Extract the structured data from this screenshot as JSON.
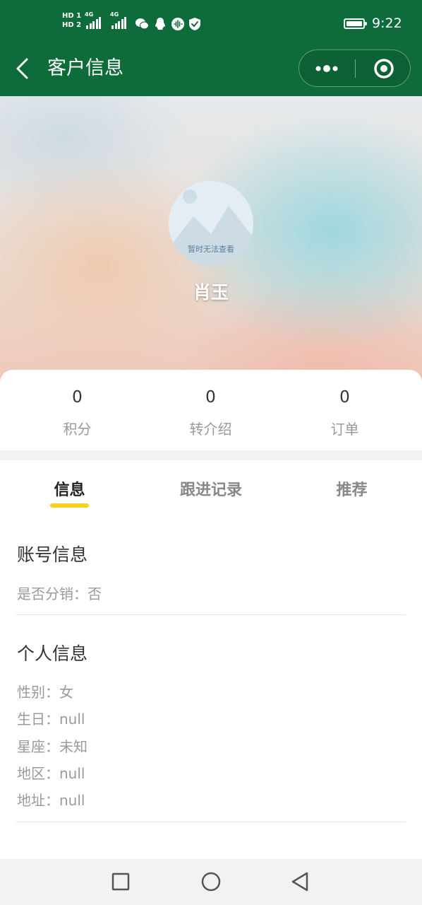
{
  "status_bar": {
    "hd1": "HD 1",
    "hd2": "HD 2",
    "net1": "4G",
    "net2": "4G",
    "battery_level": 1.0,
    "time": "9:22"
  },
  "nav": {
    "title": "客户信息",
    "back_icon": "chevron-left-icon",
    "more_icon": "more-dots-icon",
    "close_icon": "target-circle-icon",
    "color": "#0e6b3a"
  },
  "profile": {
    "avatar_placeholder": "暂时无法查看",
    "name": "肖玉"
  },
  "stats": [
    {
      "value": "0",
      "label": "积分"
    },
    {
      "value": "0",
      "label": "转介绍"
    },
    {
      "value": "0",
      "label": "订单"
    }
  ],
  "tabs": [
    {
      "label": "信息",
      "active": true
    },
    {
      "label": "跟进记录",
      "active": false
    },
    {
      "label": "推荐",
      "active": false
    }
  ],
  "account_section": {
    "title": "账号信息",
    "fields": [
      "是否分销：否"
    ]
  },
  "personal_section": {
    "title": "个人信息",
    "fields": [
      "性别：女",
      "生日：null",
      "星座：未知",
      "地区：null",
      "地址：null"
    ]
  },
  "system_nav": {
    "recent_icon": "square-icon",
    "home_icon": "circle-icon",
    "back_icon": "triangle-back-icon"
  },
  "colors": {
    "accent": "#f7d21c",
    "nav_bg": "#0e6b3a"
  }
}
